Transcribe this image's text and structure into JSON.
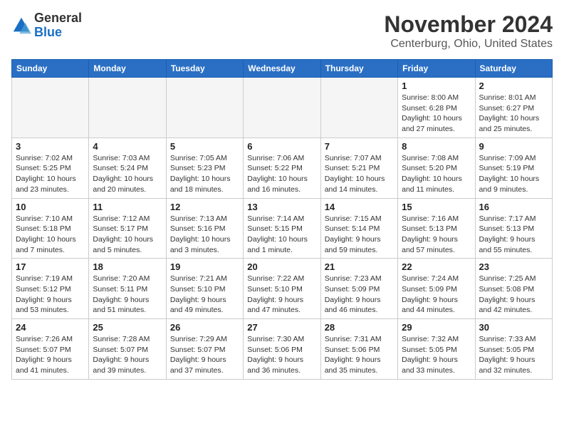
{
  "header": {
    "logo_general": "General",
    "logo_blue": "Blue",
    "month": "November 2024",
    "location": "Centerburg, Ohio, United States"
  },
  "days_of_week": [
    "Sunday",
    "Monday",
    "Tuesday",
    "Wednesday",
    "Thursday",
    "Friday",
    "Saturday"
  ],
  "weeks": [
    [
      {
        "day": "",
        "info": ""
      },
      {
        "day": "",
        "info": ""
      },
      {
        "day": "",
        "info": ""
      },
      {
        "day": "",
        "info": ""
      },
      {
        "day": "",
        "info": ""
      },
      {
        "day": "1",
        "info": "Sunrise: 8:00 AM\nSunset: 6:28 PM\nDaylight: 10 hours and 27 minutes."
      },
      {
        "day": "2",
        "info": "Sunrise: 8:01 AM\nSunset: 6:27 PM\nDaylight: 10 hours and 25 minutes."
      }
    ],
    [
      {
        "day": "3",
        "info": "Sunrise: 7:02 AM\nSunset: 5:25 PM\nDaylight: 10 hours and 23 minutes."
      },
      {
        "day": "4",
        "info": "Sunrise: 7:03 AM\nSunset: 5:24 PM\nDaylight: 10 hours and 20 minutes."
      },
      {
        "day": "5",
        "info": "Sunrise: 7:05 AM\nSunset: 5:23 PM\nDaylight: 10 hours and 18 minutes."
      },
      {
        "day": "6",
        "info": "Sunrise: 7:06 AM\nSunset: 5:22 PM\nDaylight: 10 hours and 16 minutes."
      },
      {
        "day": "7",
        "info": "Sunrise: 7:07 AM\nSunset: 5:21 PM\nDaylight: 10 hours and 14 minutes."
      },
      {
        "day": "8",
        "info": "Sunrise: 7:08 AM\nSunset: 5:20 PM\nDaylight: 10 hours and 11 minutes."
      },
      {
        "day": "9",
        "info": "Sunrise: 7:09 AM\nSunset: 5:19 PM\nDaylight: 10 hours and 9 minutes."
      }
    ],
    [
      {
        "day": "10",
        "info": "Sunrise: 7:10 AM\nSunset: 5:18 PM\nDaylight: 10 hours and 7 minutes."
      },
      {
        "day": "11",
        "info": "Sunrise: 7:12 AM\nSunset: 5:17 PM\nDaylight: 10 hours and 5 minutes."
      },
      {
        "day": "12",
        "info": "Sunrise: 7:13 AM\nSunset: 5:16 PM\nDaylight: 10 hours and 3 minutes."
      },
      {
        "day": "13",
        "info": "Sunrise: 7:14 AM\nSunset: 5:15 PM\nDaylight: 10 hours and 1 minute."
      },
      {
        "day": "14",
        "info": "Sunrise: 7:15 AM\nSunset: 5:14 PM\nDaylight: 9 hours and 59 minutes."
      },
      {
        "day": "15",
        "info": "Sunrise: 7:16 AM\nSunset: 5:13 PM\nDaylight: 9 hours and 57 minutes."
      },
      {
        "day": "16",
        "info": "Sunrise: 7:17 AM\nSunset: 5:13 PM\nDaylight: 9 hours and 55 minutes."
      }
    ],
    [
      {
        "day": "17",
        "info": "Sunrise: 7:19 AM\nSunset: 5:12 PM\nDaylight: 9 hours and 53 minutes."
      },
      {
        "day": "18",
        "info": "Sunrise: 7:20 AM\nSunset: 5:11 PM\nDaylight: 9 hours and 51 minutes."
      },
      {
        "day": "19",
        "info": "Sunrise: 7:21 AM\nSunset: 5:10 PM\nDaylight: 9 hours and 49 minutes."
      },
      {
        "day": "20",
        "info": "Sunrise: 7:22 AM\nSunset: 5:10 PM\nDaylight: 9 hours and 47 minutes."
      },
      {
        "day": "21",
        "info": "Sunrise: 7:23 AM\nSunset: 5:09 PM\nDaylight: 9 hours and 46 minutes."
      },
      {
        "day": "22",
        "info": "Sunrise: 7:24 AM\nSunset: 5:09 PM\nDaylight: 9 hours and 44 minutes."
      },
      {
        "day": "23",
        "info": "Sunrise: 7:25 AM\nSunset: 5:08 PM\nDaylight: 9 hours and 42 minutes."
      }
    ],
    [
      {
        "day": "24",
        "info": "Sunrise: 7:26 AM\nSunset: 5:07 PM\nDaylight: 9 hours and 41 minutes."
      },
      {
        "day": "25",
        "info": "Sunrise: 7:28 AM\nSunset: 5:07 PM\nDaylight: 9 hours and 39 minutes."
      },
      {
        "day": "26",
        "info": "Sunrise: 7:29 AM\nSunset: 5:07 PM\nDaylight: 9 hours and 37 minutes."
      },
      {
        "day": "27",
        "info": "Sunrise: 7:30 AM\nSunset: 5:06 PM\nDaylight: 9 hours and 36 minutes."
      },
      {
        "day": "28",
        "info": "Sunrise: 7:31 AM\nSunset: 5:06 PM\nDaylight: 9 hours and 35 minutes."
      },
      {
        "day": "29",
        "info": "Sunrise: 7:32 AM\nSunset: 5:05 PM\nDaylight: 9 hours and 33 minutes."
      },
      {
        "day": "30",
        "info": "Sunrise: 7:33 AM\nSunset: 5:05 PM\nDaylight: 9 hours and 32 minutes."
      }
    ]
  ]
}
